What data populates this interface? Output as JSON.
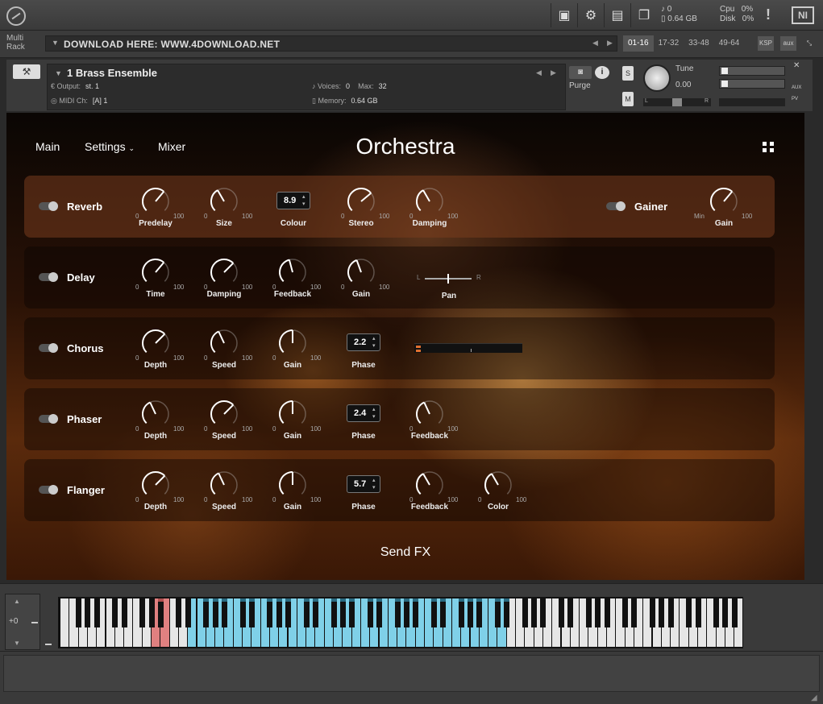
{
  "topbar": {
    "icons": [
      "save-icon",
      "gear-icon",
      "layout-icon",
      "window-icon"
    ],
    "stats": {
      "midi": "0",
      "memory": "0.64 GB",
      "cpu_label": "Cpu",
      "cpu": "0%",
      "disk_label": "Disk",
      "disk": "0%"
    },
    "warn": "!",
    "ni_logo": "NI"
  },
  "rack": {
    "label_line1": "Multi",
    "label_line2": "Rack",
    "preset_text": "DOWNLOAD HERE: WWW.4DOWNLOAD.NET",
    "tabs": [
      "01-16",
      "17-32",
      "33-48",
      "49-64"
    ],
    "ksp": "KSP",
    "aux": "aux"
  },
  "instrument": {
    "name": "1 Brass Ensemble",
    "output_label": "Output:",
    "output_value": "st. 1",
    "voices_label": "Voices:",
    "voices_value": "0",
    "max_label": "Max:",
    "max_value": "32",
    "midi_label": "MIDI Ch:",
    "midi_value": "[A]  1",
    "memory_label": "Memory:",
    "memory_value": "0.64 GB",
    "purge": "Purge",
    "solo": "S",
    "mute": "M",
    "tune_label": "Tune",
    "tune_value": "0.00",
    "pan_l": "L",
    "pan_r": "R",
    "aux_label": "AUX",
    "pv_label": "PV"
  },
  "ui": {
    "nav": {
      "main": "Main",
      "settings": "Settings",
      "mixer": "Mixer"
    },
    "title": "Orchestra",
    "send_fx": "Send FX",
    "min": "0",
    "max": "100",
    "gainer_min": "Min",
    "pan_l": "L",
    "pan_r": "R"
  },
  "fx": {
    "reverb": {
      "name": "Reverb",
      "predelay": "Predelay",
      "size": "Size",
      "colour": "Colour",
      "colour_value": "8.9",
      "stereo": "Stereo",
      "damping": "Damping"
    },
    "gainer": {
      "name": "Gainer",
      "gain": "Gain"
    },
    "delay": {
      "name": "Delay",
      "time": "Time",
      "damping": "Damping",
      "feedback": "Feedback",
      "gain": "Gain",
      "pan": "Pan"
    },
    "chorus": {
      "name": "Chorus",
      "depth": "Depth",
      "speed": "Speed",
      "gain": "Gain",
      "phase": "Phase",
      "phase_value": "2.2"
    },
    "phaser": {
      "name": "Phaser",
      "depth": "Depth",
      "speed": "Speed",
      "gain": "Gain",
      "phase": "Phase",
      "phase_value": "2.4",
      "feedback": "Feedback"
    },
    "flanger": {
      "name": "Flanger",
      "depth": "Depth",
      "speed": "Speed",
      "gain": "Gain",
      "phase": "Phase",
      "phase_value": "5.7",
      "feedback": "Feedback",
      "color": "Color"
    }
  },
  "keyboard": {
    "octave": "+0",
    "highlight_color": "#7fd0e8",
    "keyswitch_color": "#e08080"
  },
  "colors": {
    "accent": "#ffffff",
    "panel_bg": "#3a3a3a"
  }
}
